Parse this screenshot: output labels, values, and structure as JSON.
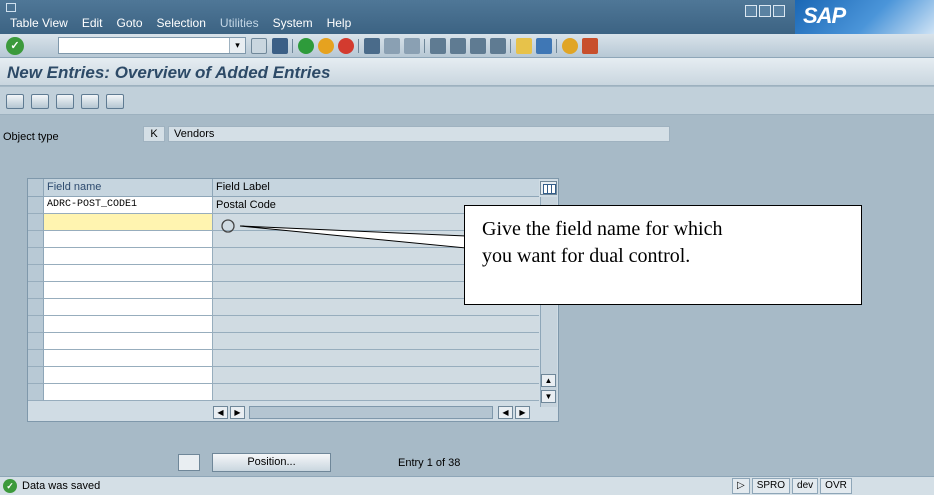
{
  "menu": {
    "items": [
      "Table View",
      "Edit",
      "Goto",
      "Selection",
      "Utilities",
      "System",
      "Help"
    ]
  },
  "brand": {
    "logo_text": "SAP"
  },
  "toolbar": {
    "command_value": ""
  },
  "title": "New Entries: Overview of Added Entries",
  "object_type": {
    "label": "Object type",
    "key": "K",
    "description": "Vendors"
  },
  "table": {
    "columns": [
      "Field name",
      "Field Label"
    ],
    "rows": [
      {
        "field_name": "ADRC-POST_CODE1",
        "field_label": "Postal Code"
      },
      {
        "field_name": "",
        "field_label": ""
      },
      {
        "field_name": "",
        "field_label": ""
      },
      {
        "field_name": "",
        "field_label": ""
      },
      {
        "field_name": "",
        "field_label": ""
      },
      {
        "field_name": "",
        "field_label": ""
      },
      {
        "field_name": "",
        "field_label": ""
      },
      {
        "field_name": "",
        "field_label": ""
      },
      {
        "field_name": "",
        "field_label": ""
      },
      {
        "field_name": "",
        "field_label": ""
      },
      {
        "field_name": "",
        "field_label": ""
      },
      {
        "field_name": "",
        "field_label": ""
      }
    ]
  },
  "callout": {
    "line1": "Give the field name for which",
    "line2": "you want for dual control."
  },
  "bottom": {
    "position_button": "Position...",
    "entry_info": "Entry 1 of 38"
  },
  "status": {
    "message": "Data was saved",
    "transaction": "SPRO",
    "system": "dev",
    "mode": "OVR"
  },
  "colors": {
    "background": "#a7bac7",
    "menu_bar": "#4f7797",
    "title_text": "#2d4a67",
    "active_cell": "#fff4b0"
  }
}
